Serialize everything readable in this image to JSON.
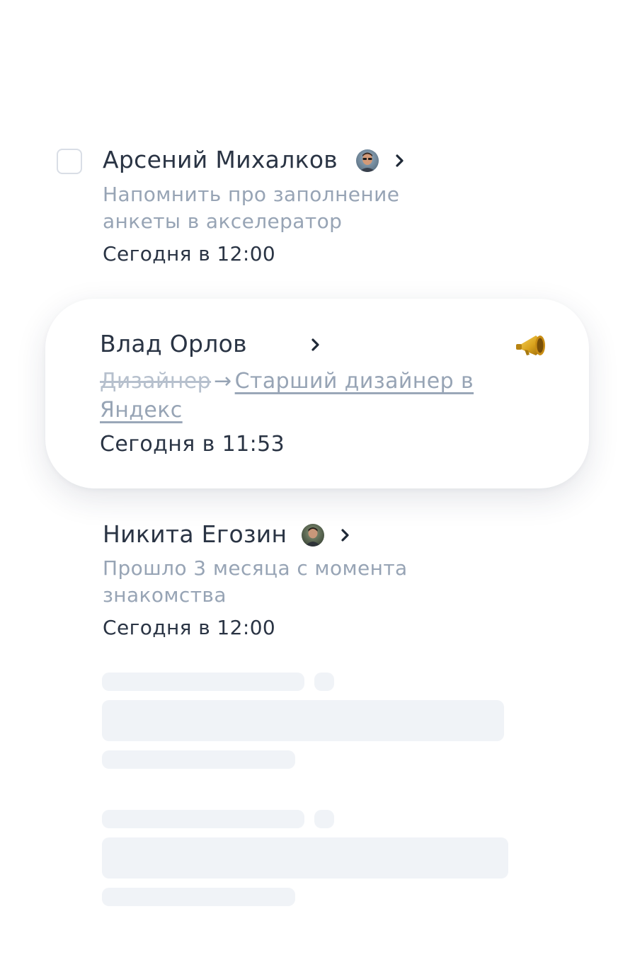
{
  "tasks": [
    {
      "name": "Арсений Михалков",
      "description": "Напомнить про заполнение анкеты в акселератор",
      "time": "Сегодня в 12:00",
      "avatar_icon": "person-avatar",
      "checked": false
    },
    {
      "name": "Влад Орлов",
      "old_position": "Дизайнер",
      "arrow": "→",
      "new_position": "Старший дизайнер в Яндекс",
      "time": "Сегодня в 11:53",
      "badge_icon": "megaphone-icon"
    },
    {
      "name": "Никита Егозин",
      "description": "Прошло 3 месяца с момента знакомства",
      "time": "Сегодня в 12:00",
      "avatar_icon": "person-avatar"
    }
  ],
  "colors": {
    "primary_text": "#2a3444",
    "secondary_text": "#97a4b5",
    "skeleton": "#f0f3f7",
    "checkbox_border": "#d9dee6"
  }
}
